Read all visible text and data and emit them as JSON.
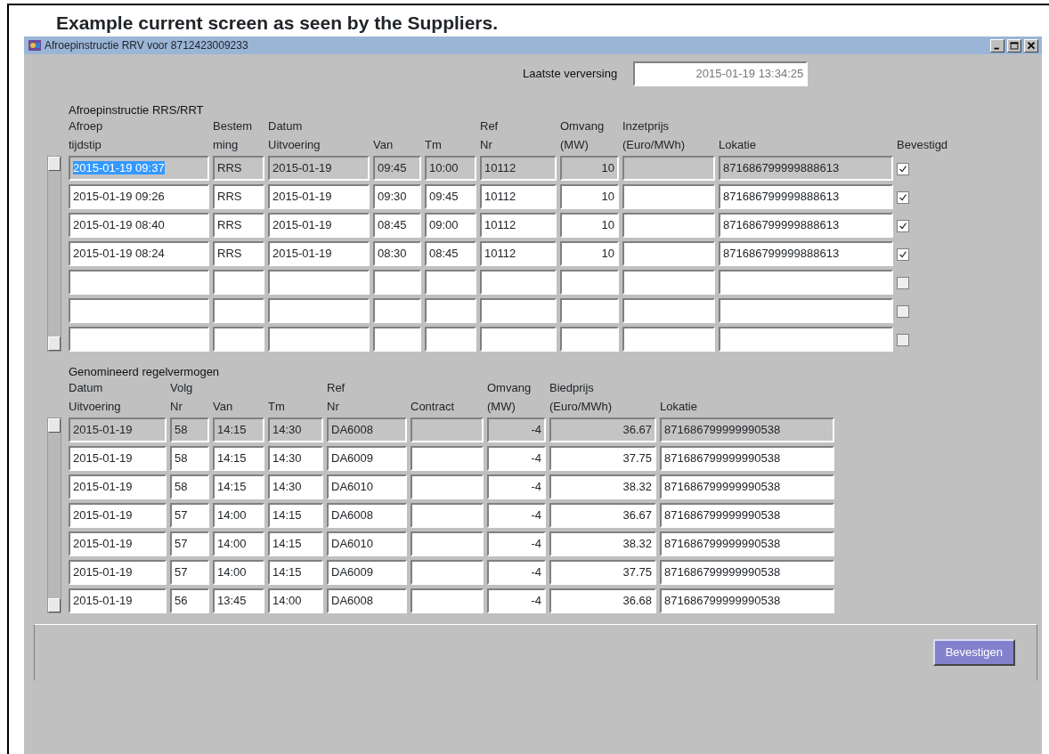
{
  "heading": "Example current screen as seen by the Suppliers.",
  "window": {
    "title": "Afroepinstructie RRV voor 8712423009233"
  },
  "refresh": {
    "label": "Laatste verversing",
    "value": "2015-01-19 13:34:25"
  },
  "calls": {
    "title": "Afroepinstructie RRS/RRT",
    "columns": [
      {
        "lines": [
          "Afroep",
          "tijdstip"
        ],
        "kind": "text"
      },
      {
        "lines": [
          "Bestem",
          "ming"
        ],
        "kind": "text"
      },
      {
        "lines": [
          "Datum",
          "Uitvoering"
        ],
        "kind": "text"
      },
      {
        "lines": [
          "Van"
        ],
        "kind": "text"
      },
      {
        "lines": [
          "Tm"
        ],
        "kind": "text"
      },
      {
        "lines": [
          "Ref",
          "Nr"
        ],
        "kind": "text"
      },
      {
        "lines": [
          "Omvang",
          "(MW)"
        ],
        "kind": "number"
      },
      {
        "lines": [
          "Inzetprijs",
          "(Euro/MWh)"
        ],
        "kind": "text"
      },
      {
        "lines": [
          "Lokatie"
        ],
        "kind": "text"
      }
    ],
    "check_column": "Bevestigd",
    "rows": [
      {
        "current": true,
        "checked": true,
        "cells": [
          "2015-01-19 09:37",
          "RRS",
          "2015-01-19",
          "09:45",
          "10:00",
          "10112",
          "10",
          "",
          "871686799999888613"
        ]
      },
      {
        "current": false,
        "checked": true,
        "cells": [
          "2015-01-19 09:26",
          "RRS",
          "2015-01-19",
          "09:30",
          "09:45",
          "10112",
          "10",
          "",
          "871686799999888613"
        ]
      },
      {
        "current": false,
        "checked": true,
        "cells": [
          "2015-01-19 08:40",
          "RRS",
          "2015-01-19",
          "08:45",
          "09:00",
          "10112",
          "10",
          "",
          "871686799999888613"
        ]
      },
      {
        "current": false,
        "checked": true,
        "cells": [
          "2015-01-19 08:24",
          "RRS",
          "2015-01-19",
          "08:30",
          "08:45",
          "10112",
          "10",
          "",
          "871686799999888613"
        ]
      },
      {
        "current": false,
        "checked": false
      },
      {
        "current": false,
        "checked": false
      },
      {
        "current": false,
        "checked": false
      }
    ]
  },
  "nominated": {
    "title": "Genomineerd regelvermogen",
    "columns": [
      {
        "lines": [
          "Datum",
          "Uitvoering"
        ],
        "kind": "text"
      },
      {
        "lines": [
          "Volg",
          "Nr"
        ],
        "kind": "text"
      },
      {
        "lines": [
          "Van"
        ],
        "kind": "text"
      },
      {
        "lines": [
          "Tm"
        ],
        "kind": "text"
      },
      {
        "lines": [
          "Ref",
          "Nr"
        ],
        "kind": "text"
      },
      {
        "lines": [
          "Contract"
        ],
        "kind": "text"
      },
      {
        "lines": [
          "Omvang",
          "(MW)"
        ],
        "kind": "number"
      },
      {
        "lines": [
          "Biedprijs",
          "(Euro/MWh)"
        ],
        "kind": "number"
      },
      {
        "lines": [
          "Lokatie"
        ],
        "kind": "text"
      }
    ],
    "rows": [
      {
        "current": true,
        "cells": [
          "2015-01-19",
          "58",
          "14:15",
          "14:30",
          "DA6008",
          "",
          "-4",
          "36.67",
          "871686799999990538"
        ]
      },
      {
        "current": false,
        "cells": [
          "2015-01-19",
          "58",
          "14:15",
          "14:30",
          "DA6009",
          "",
          "-4",
          "37.75",
          "871686799999990538"
        ]
      },
      {
        "current": false,
        "cells": [
          "2015-01-19",
          "58",
          "14:15",
          "14:30",
          "DA6010",
          "",
          "-4",
          "38.32",
          "871686799999990538"
        ]
      },
      {
        "current": false,
        "cells": [
          "2015-01-19",
          "57",
          "14:00",
          "14:15",
          "DA6008",
          "",
          "-4",
          "36.67",
          "871686799999990538"
        ]
      },
      {
        "current": false,
        "cells": [
          "2015-01-19",
          "57",
          "14:00",
          "14:15",
          "DA6010",
          "",
          "-4",
          "38.32",
          "871686799999990538"
        ]
      },
      {
        "current": false,
        "cells": [
          "2015-01-19",
          "57",
          "14:00",
          "14:15",
          "DA6009",
          "",
          "-4",
          "37.75",
          "871686799999990538"
        ]
      },
      {
        "current": false,
        "cells": [
          "2015-01-19",
          "56",
          "13:45",
          "14:00",
          "DA6008",
          "",
          "-4",
          "36.68",
          "871686799999990538"
        ]
      }
    ]
  },
  "confirm_button": "Bevestigen"
}
